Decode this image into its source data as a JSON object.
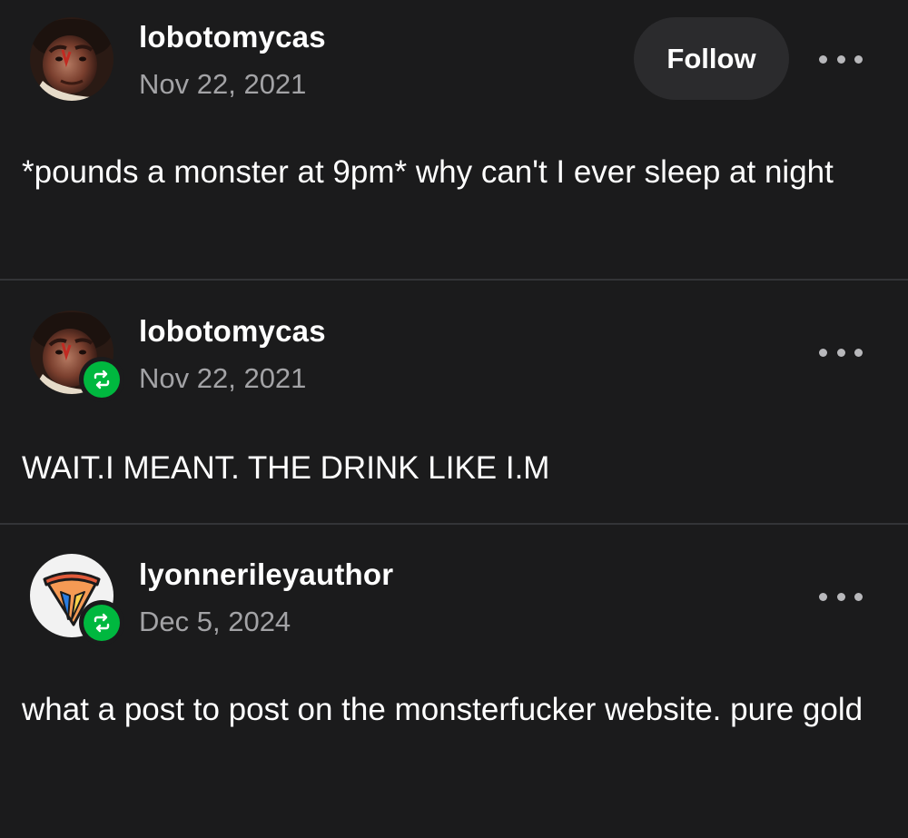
{
  "posts": [
    {
      "username": "lobotomycas",
      "date": "Nov 22, 2021",
      "follow_label": "Follow",
      "body": "*pounds a monster at 9pm* why can't I ever sleep at night",
      "avatar_icon": "user-photo-avatar",
      "more_icon": "ellipsis-icon"
    },
    {
      "username": "lobotomycas",
      "date": "Nov 22, 2021",
      "body": "WAIT.I MEANT. THE DRINK LIKE I.M",
      "avatar_icon": "user-photo-avatar",
      "badge_icon": "reblog-icon",
      "more_icon": "ellipsis-icon"
    },
    {
      "username": "lyonnerileyauthor",
      "date": "Dec 5, 2024",
      "body": "what a post to post on the monsterfucker website. pure gold",
      "avatar_icon": "pizza-slice-avatar",
      "badge_icon": "reblog-icon",
      "more_icon": "ellipsis-icon"
    }
  ],
  "colors": {
    "background": "#1b1b1c",
    "divider": "#333437",
    "follow_button": "#2b2b2d",
    "reblog_green": "#00b83f",
    "date_gray": "#a3a3a6"
  }
}
